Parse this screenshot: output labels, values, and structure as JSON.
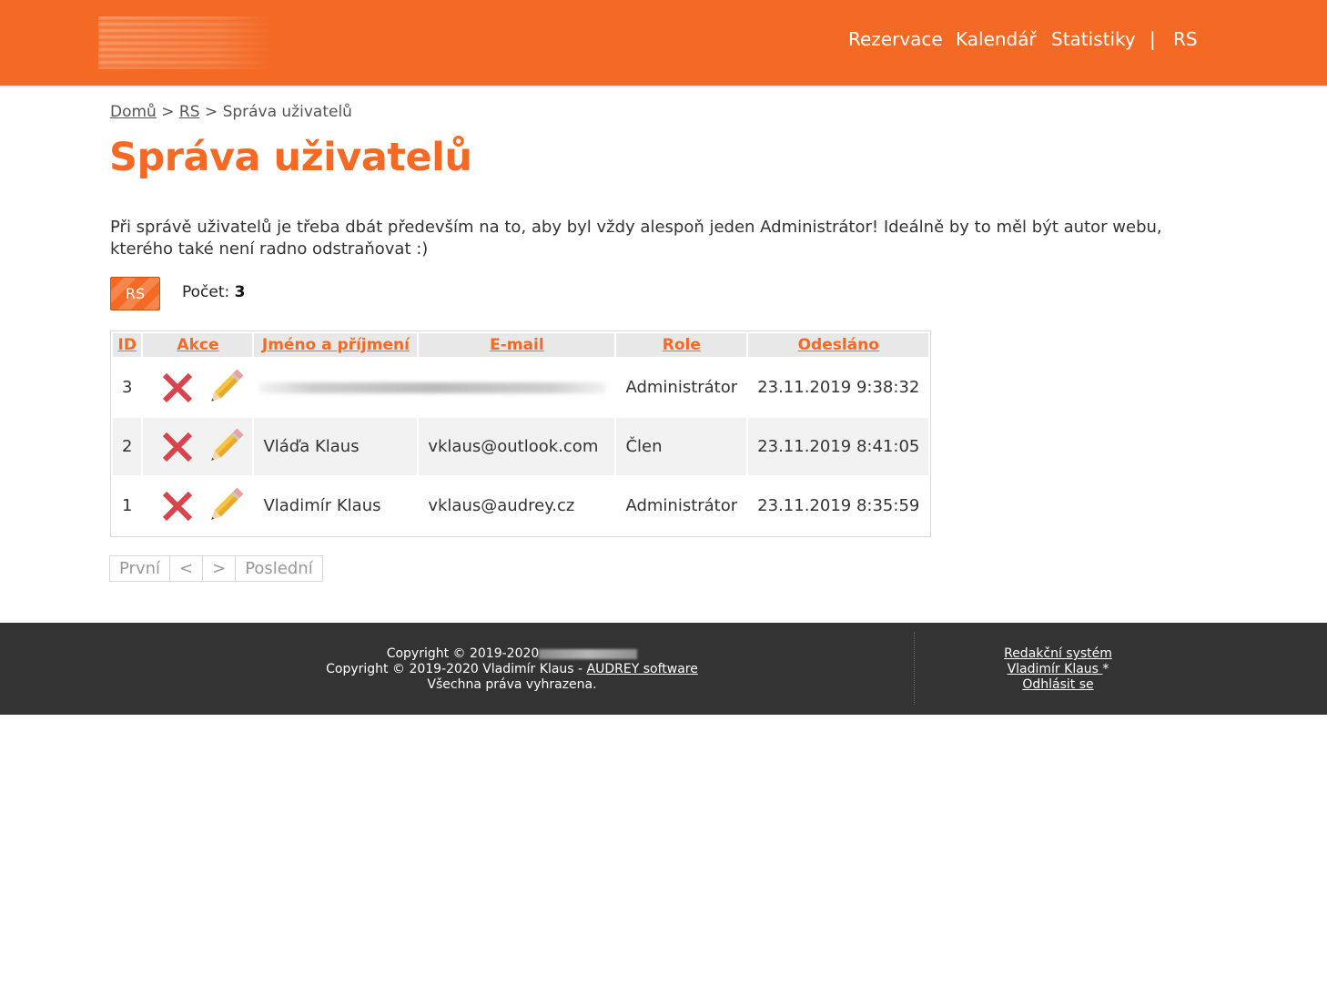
{
  "nav": {
    "items": [
      {
        "label": "Rezervace"
      },
      {
        "label": "Kalendář"
      },
      {
        "label": "Statistiky"
      },
      {
        "label": "|"
      },
      {
        "label": "RS"
      }
    ]
  },
  "breadcrumb": {
    "home": "Domů",
    "separator": ">",
    "rs": "RS",
    "current": "Správa uživatelů"
  },
  "page": {
    "title": "Správa uživatelů",
    "intro": "Při správě uživatelů je třeba dbát především na to, aby byl vždy alespoň jeden Administrátor! Ideálně by to měl být autor webu, kterého také není radno odstraňovat :)"
  },
  "toolbar": {
    "rs_button": "RS",
    "count_label": "Počet:",
    "count_value": "3"
  },
  "table": {
    "headers": [
      "ID",
      "Akce",
      "Jméno a příjmení",
      "E-mail",
      "Role",
      "Odesláno"
    ],
    "rows": [
      {
        "id": "3",
        "name": "",
        "email": "",
        "role": "Administrátor",
        "sent": "23.11.2019 9:38:32"
      },
      {
        "id": "2",
        "name": "Vláďa Klaus",
        "email": "vklaus@outlook.com",
        "role": "Člen",
        "sent": "23.11.2019 8:41:05"
      },
      {
        "id": "1",
        "name": "Vladimír Klaus",
        "email": "vklaus@audrey.cz",
        "role": "Administrátor",
        "sent": "23.11.2019 8:35:59"
      }
    ],
    "action_icons": [
      "delete-icon",
      "edit-pencil-icon"
    ]
  },
  "pager": {
    "first": "První",
    "prev": "<",
    "next": ">",
    "last": "Poslední"
  },
  "footer": {
    "copyright_1": "Copyright © 2019-2020",
    "copyright_2_prefix": "Copyright © 2019-2020 Vladimír Klaus - ",
    "audrey_link": "AUDREY software",
    "rights": "Všechna práva vyhrazena.",
    "cms_link": "Redakční systém",
    "user_link": "Vladimír Klaus ",
    "user_suffix": "*",
    "logout_link": "Odhlásit se"
  },
  "colors": {
    "brand_orange": "#f46a25",
    "footer_bg": "#333333",
    "delete_red": "#d9434b",
    "pencil_yellow": "#f5c445"
  }
}
